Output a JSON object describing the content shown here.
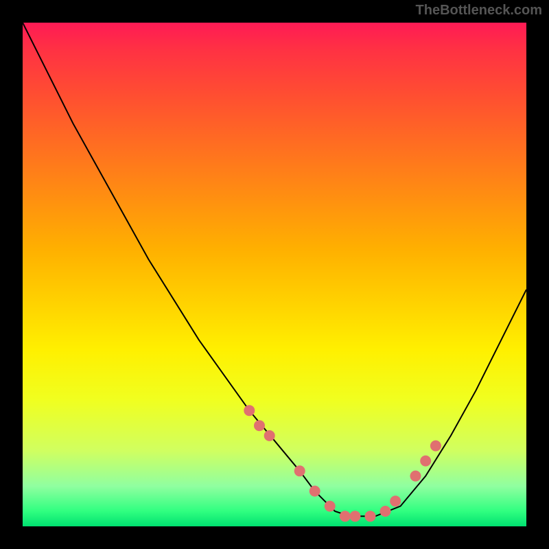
{
  "watermark": "TheBottleneck.com",
  "chart_data": {
    "type": "line",
    "title": "",
    "xlabel": "",
    "ylabel": "",
    "xlim": [
      0,
      100
    ],
    "ylim": [
      0,
      100
    ],
    "series": [
      {
        "name": "curve",
        "x": [
          0,
          5,
          10,
          15,
          20,
          25,
          30,
          35,
          40,
          45,
          50,
          55,
          58,
          60,
          62,
          65,
          70,
          75,
          80,
          85,
          90,
          95,
          100
        ],
        "y": [
          100,
          90,
          80,
          71,
          62,
          53,
          45,
          37,
          30,
          23,
          17,
          11,
          7,
          5,
          3,
          2,
          2,
          4,
          10,
          18,
          27,
          37,
          47
        ]
      }
    ],
    "markers": {
      "name": "highlight-points",
      "color": "#e07070",
      "x": [
        45,
        47,
        49,
        55,
        58,
        61,
        64,
        66,
        69,
        72,
        74,
        78,
        80,
        82
      ],
      "y": [
        23,
        20,
        18,
        11,
        7,
        4,
        2,
        2,
        2,
        3,
        5,
        10,
        13,
        16
      ]
    }
  }
}
